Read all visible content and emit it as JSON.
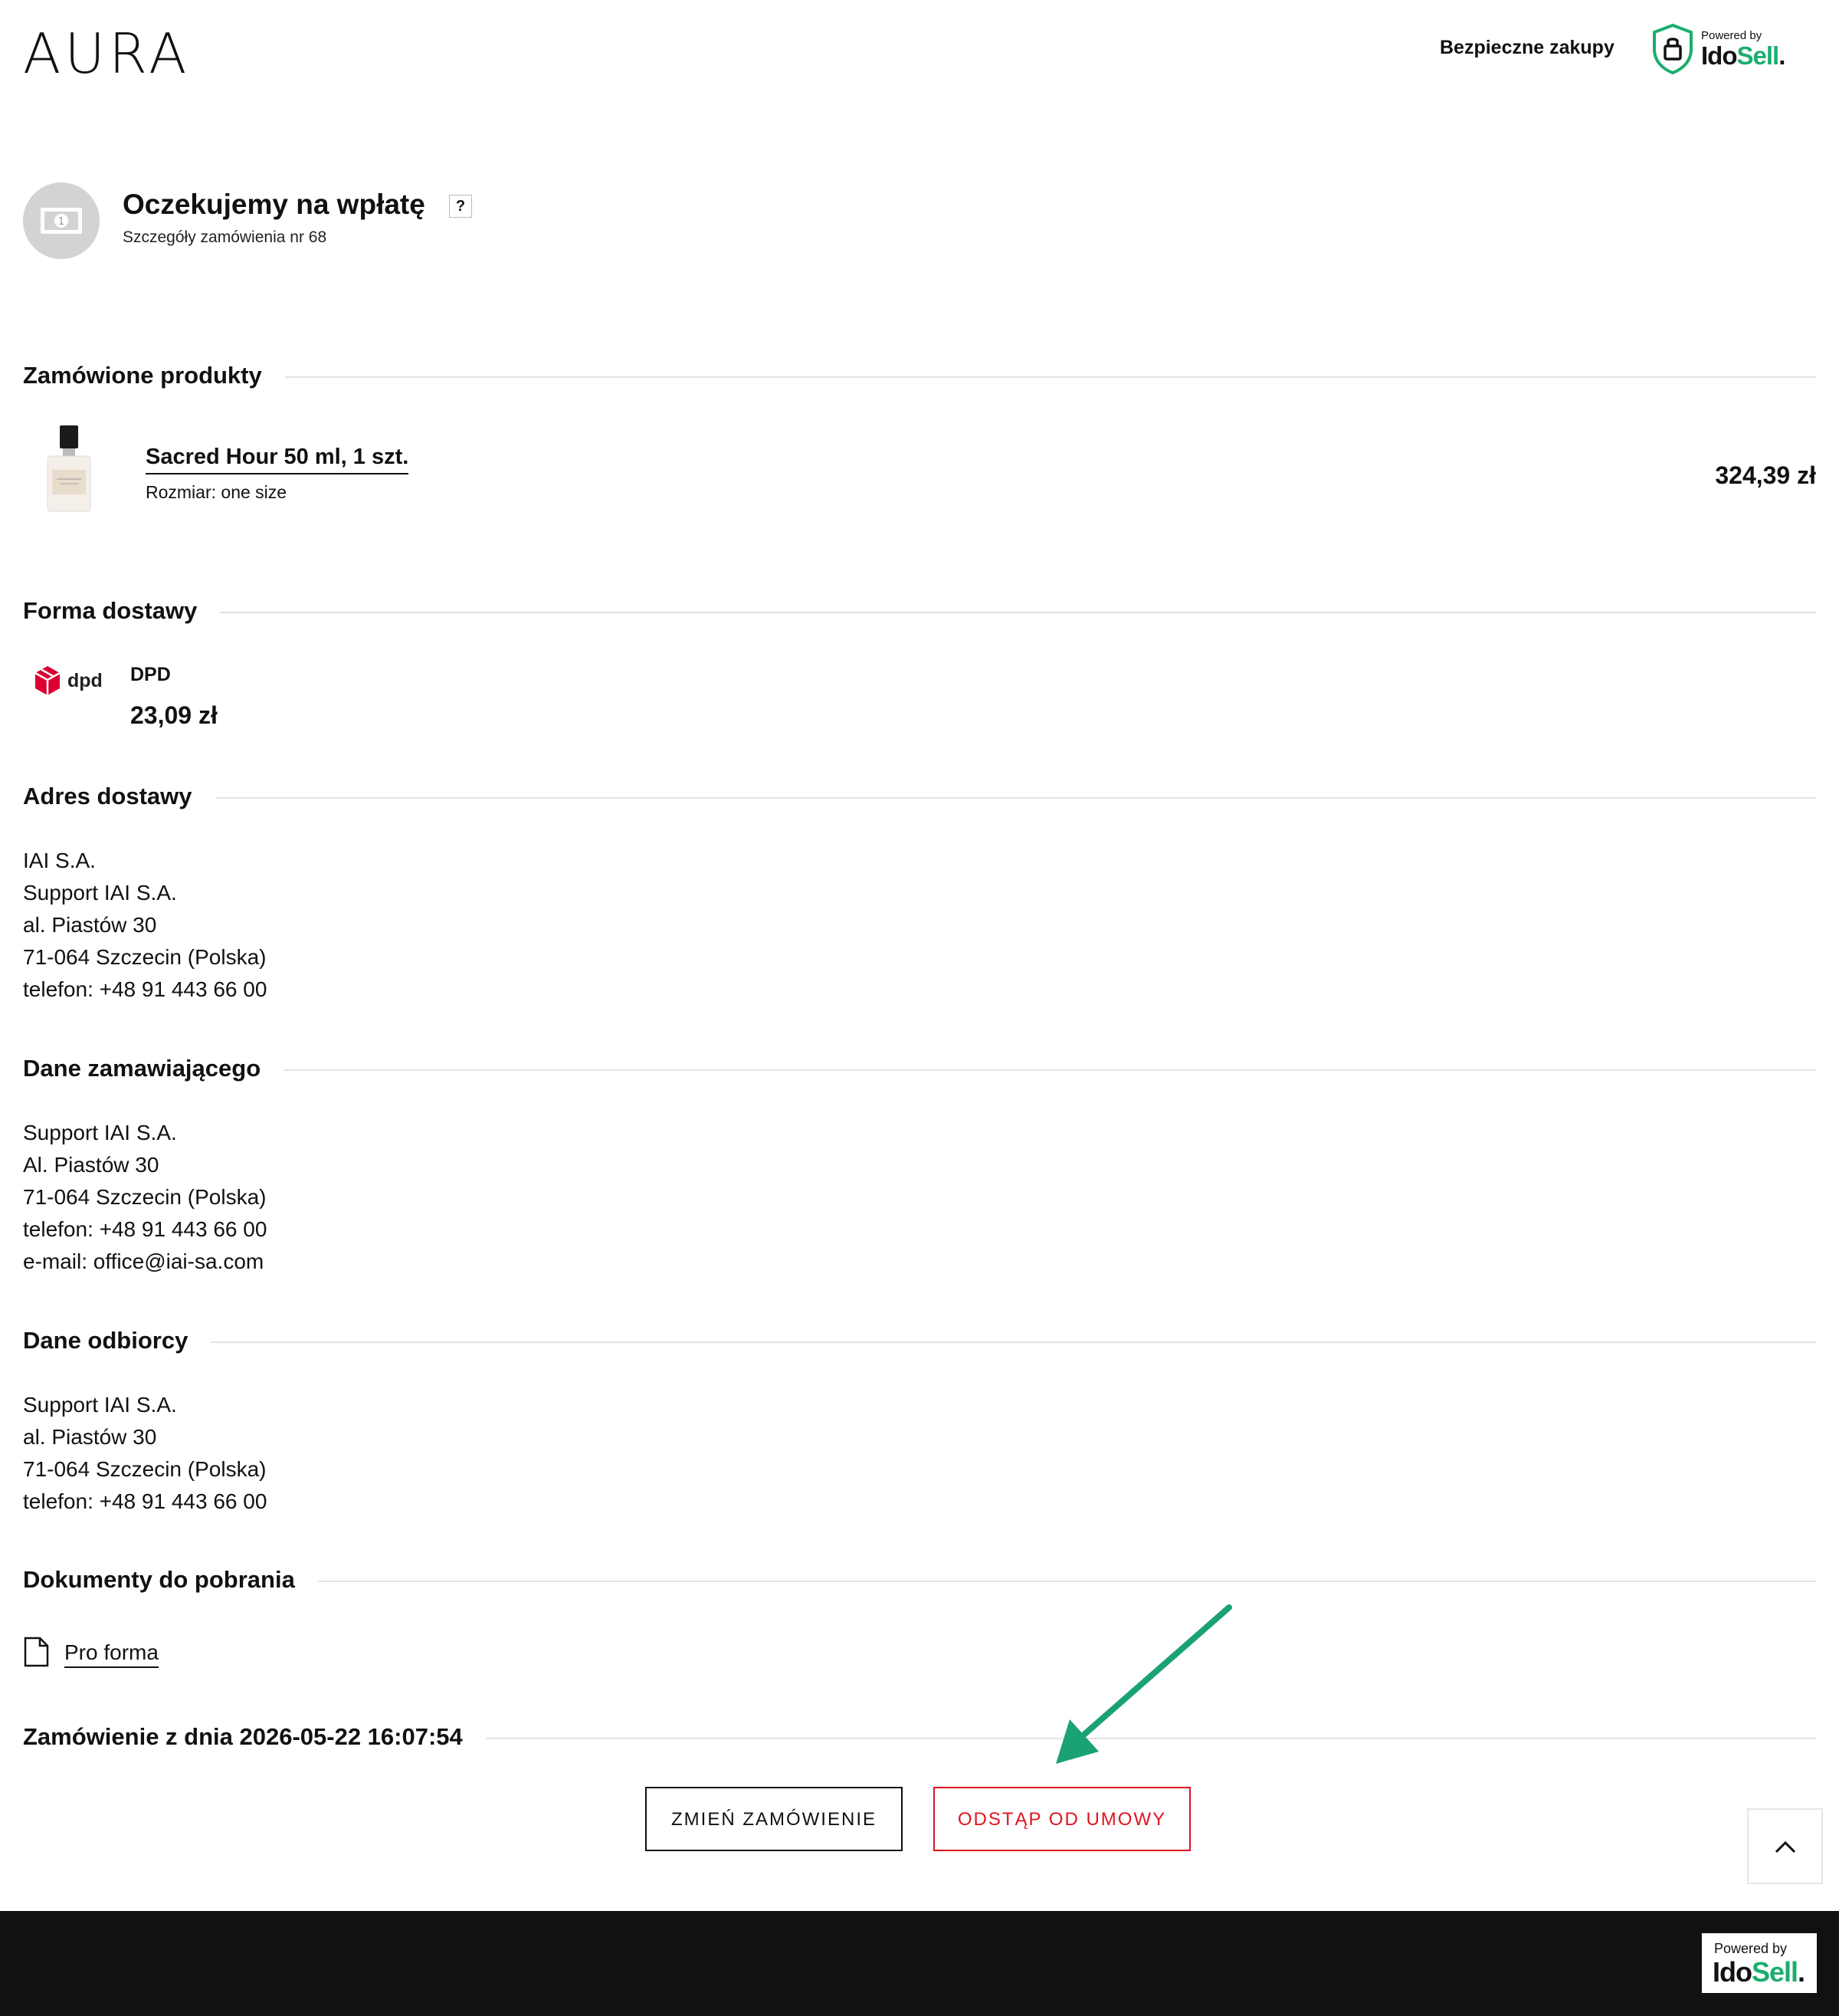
{
  "header": {
    "logo": "AURA",
    "secure_text": "Bezpieczne zakupy",
    "badge_powered": "Powered by",
    "badge_brand_a": "Ido",
    "badge_brand_b": "Sell",
    "badge_brand_dot": "."
  },
  "status": {
    "title": "Oczekujemy na wpłatę",
    "help": "?",
    "subtitle": "Szczegóły zamówienia nr 68",
    "icon": "banknote-icon"
  },
  "sections": {
    "products": "Zamówione produkty",
    "delivery": "Forma dostawy",
    "delivery_address": "Adres dostawy",
    "orderer": "Dane zamawiającego",
    "recipient": "Dane odbiorcy",
    "documents": "Dokumenty do pobrania",
    "order_date": "Zamówienie z dnia 2026-05-22 16:07:54"
  },
  "product": {
    "name": "Sacred Hour 50 ml, 1 szt.",
    "size": "Rozmiar: one size",
    "price": "324,39 zł"
  },
  "shipping": {
    "logo_text": "dpd",
    "name": "DPD",
    "price": "23,09 zł"
  },
  "delivery_address": [
    "IAI S.A.",
    "Support IAI S.A.",
    "al. Piastów 30",
    "71-064 Szczecin (Polska)",
    "telefon: +48 91 443 66 00"
  ],
  "orderer": [
    "Support IAI S.A.",
    "Al. Piastów 30",
    "71-064 Szczecin (Polska)",
    "telefon: +48 91 443 66 00",
    "e-mail: office@iai-sa.com"
  ],
  "recipient": [
    "Support IAI S.A.",
    "al. Piastów 30",
    "71-064 Szczecin (Polska)",
    "telefon: +48 91 443 66 00"
  ],
  "documents": {
    "proforma": "Pro forma"
  },
  "actions": {
    "change_order": "ZMIEŃ ZAMÓWIENIE",
    "withdraw": "ODSTĄP OD UMOWY"
  },
  "footer": {
    "powered": "Powered by",
    "brand_a": "Ido",
    "brand_b": "Sell",
    "brand_dot": "."
  },
  "colors": {
    "accent_green": "#1aae6f",
    "danger_red": "#e0131f",
    "dpd_red": "#dc0032",
    "footer_bg": "#111111"
  }
}
